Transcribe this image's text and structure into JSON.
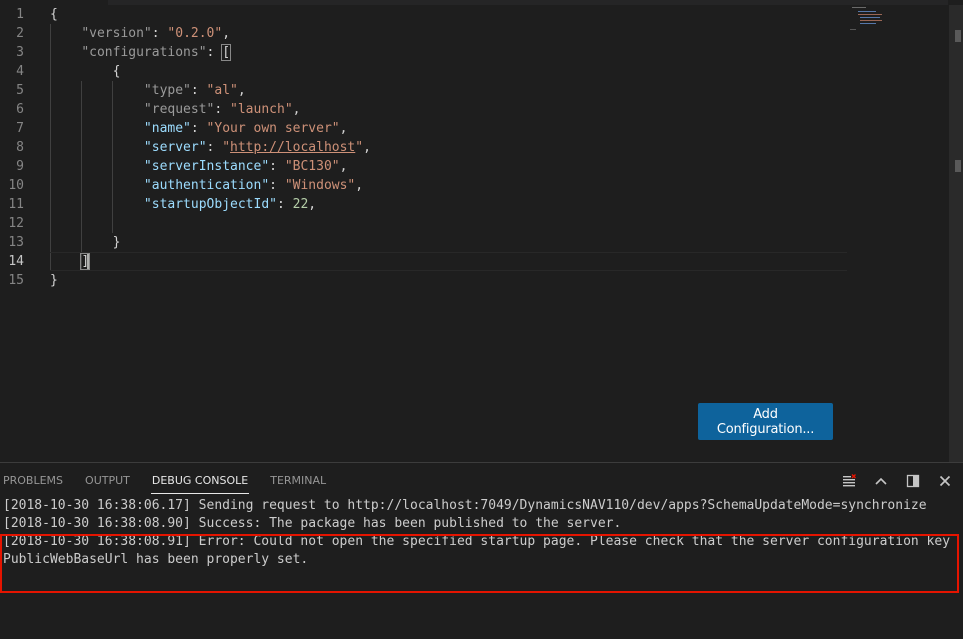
{
  "editor": {
    "line_numbers": [
      "1",
      "2",
      "3",
      "4",
      "5",
      "6",
      "7",
      "8",
      "9",
      "10",
      "11",
      "12",
      "13",
      "14",
      "15"
    ],
    "brace_open": "{",
    "brace_close": "}",
    "comma": ",",
    "colon": ":",
    "version_key": "\"version\"",
    "version_value": "\"0.2.0\"",
    "configurations_key": "\"configurations\"",
    "bracket_open": "[",
    "bracket_close": "]",
    "type_key": "\"type\"",
    "type_value": "\"al\"",
    "request_key": "\"request\"",
    "request_value": "\"launch\"",
    "name_key": "\"name\"",
    "name_value": "\"Your own server\"",
    "server_key": "\"server\"",
    "server_quote": "\"",
    "server_url": "http://localhost",
    "serverInstance_key": "\"serverInstance\"",
    "serverInstance_value": "\"BC130\"",
    "authentication_key": "\"authentication\"",
    "authentication_value": "\"Windows\"",
    "startupObjectId_key": "\"startupObjectId\"",
    "startupObjectId_value": "22"
  },
  "add_config_button": "Add Configuration...",
  "panel": {
    "tabs": [
      "PROBLEMS",
      "OUTPUT",
      "DEBUG CONSOLE",
      "TERMINAL"
    ],
    "active_tab": "DEBUG CONSOLE",
    "console_lines": [
      "[2018-10-30 16:38:06.17] Sending request to http://localhost:7049/DynamicsNAV110/dev/apps?SchemaUpdateMode=synchronize",
      "[2018-10-30 16:38:08.90] Success: The package has been published to the server.",
      "[2018-10-30 16:38:08.91] Error: Could not open the specified startup page. Please check that the server configuration key PublicWebBaseUrl has been properly set."
    ]
  },
  "colors": {
    "accent_button": "#0e639c",
    "highlight_box": "#e51400",
    "string": "#ce9178",
    "key": "#9cdcfe",
    "number": "#b5cea8"
  }
}
